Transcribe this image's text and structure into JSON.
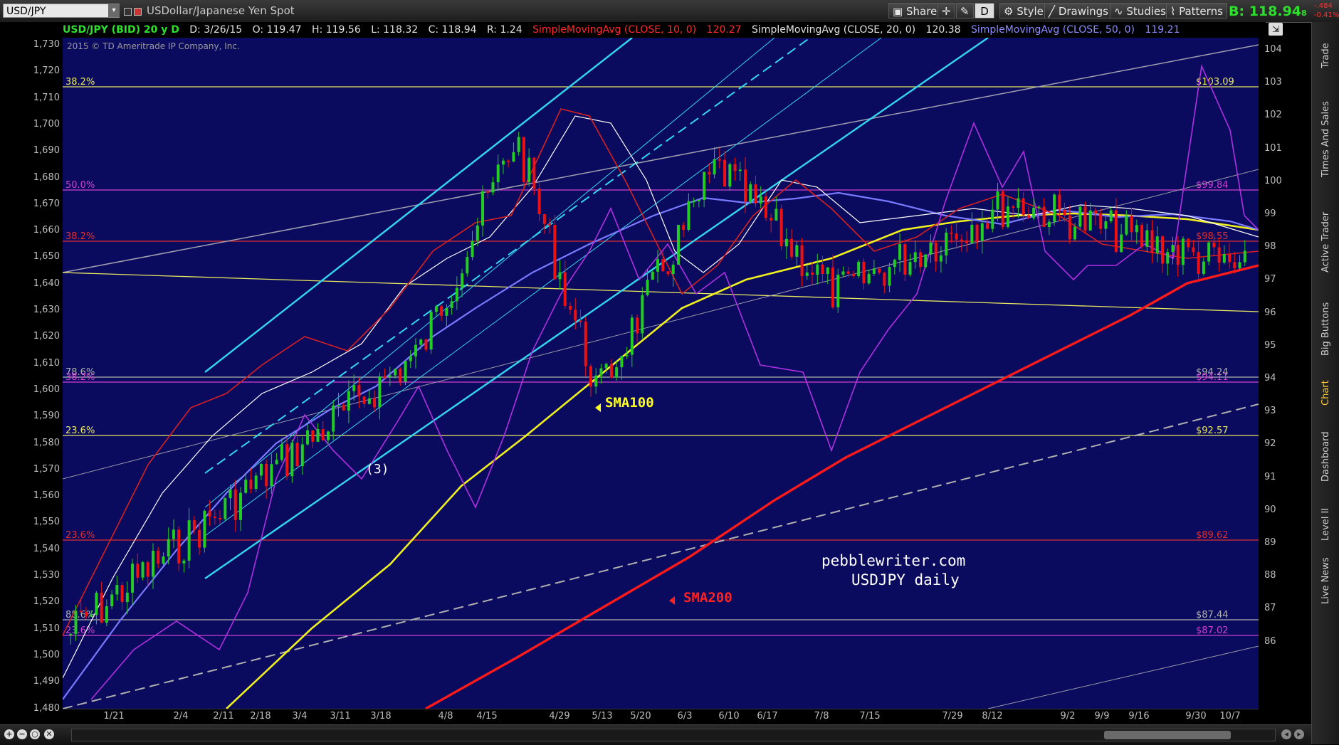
{
  "toolbar": {
    "symbol": "USD/JPY",
    "description": "USDollar/Japanese Yen Spot",
    "buttons": [
      "Share",
      "Style",
      "Drawings",
      "Studies",
      "Patterns"
    ],
    "d_button": "D",
    "quote_b": "B: 118.94",
    "quote_b_sub": "8",
    "change_top": "-.484",
    "change_bottom": "-0.41%"
  },
  "infobar": {
    "symbol": "USD/JPY (BID) 20 y D",
    "date": "D: 3/26/15",
    "open": "O: 119.47",
    "high": "H: 119.56",
    "low": "L: 118.32",
    "close": "C: 118.94",
    "range": "R: 1.24",
    "sma10": "SimpleMovingAvg (CLOSE, 10, 0)",
    "sma10_val": "120.27",
    "sma20": "SimpleMovingAvg (CLOSE, 20, 0)",
    "sma20_val": "120.38",
    "sma50": "SimpleMovingAvg (CLOSE, 50, 0)",
    "sma50_val": "119.21"
  },
  "copyright": "2015 © TD Ameritrade IP Company, Inc.",
  "left_axis_ticks": [
    "1,730",
    "1,720",
    "1,710",
    "1,700",
    "1,690",
    "1,680",
    "1,670",
    "1,660",
    "1,650",
    "1,640",
    "1,630",
    "1,620",
    "1,610",
    "1,600",
    "1,590",
    "1,580",
    "1,570",
    "1,560",
    "1,550",
    "1,540",
    "1,530",
    "1,520",
    "1,510",
    "1,500",
    "1,490",
    "1,480"
  ],
  "right_axis_ticks": [
    "104",
    "103",
    "102",
    "101",
    "100",
    "99",
    "98",
    "97",
    "96",
    "95",
    "94",
    "93",
    "92",
    "91",
    "90",
    "89",
    "88",
    "87",
    "86"
  ],
  "x_axis_ticks": [
    "1/21",
    "2/4",
    "2/11",
    "2/18",
    "3/4",
    "3/11",
    "3/18",
    "4/8",
    "4/15",
    "4/29",
    "5/13",
    "5/20",
    "6/3",
    "6/10",
    "6/17",
    "7/8",
    "7/15",
    "7/29",
    "8/12",
    "9/2",
    "9/9",
    "9/16",
    "9/30",
    "10/7"
  ],
  "fib_levels": [
    {
      "left": "38.2%",
      "right": "$103.09",
      "color": "#e8e860"
    },
    {
      "left": "50.0%",
      "right": "$99.84",
      "color": "#d040d0"
    },
    {
      "left": "38.2%",
      "right": "$98.55",
      "color": "#e03030"
    },
    {
      "left": "78.6%",
      "right": "$94.24",
      "color": "#b0b0b0"
    },
    {
      "left": "38.2%",
      "right": "$94.11",
      "color": "#d040d0"
    },
    {
      "left": "23.6%",
      "right": "$92.57",
      "color": "#e8e860"
    },
    {
      "left": "23.6%",
      "right": "$89.62",
      "color": "#e03030"
    },
    {
      "left": "88.6%",
      "right": "$87.44",
      "color": "#b0b0b0"
    },
    {
      "left": "23.6%",
      "right": "$87.02",
      "color": "#d040d0"
    }
  ],
  "annotations": {
    "sma100": "SMA100",
    "sma200": "SMA200",
    "wave": "(3)",
    "site": "pebblewriter.com",
    "subtitle": "USDJPY daily"
  },
  "side_tabs": [
    "Trade",
    "Times And Sales",
    "Active Trader",
    "Big Buttons",
    "Chart",
    "Dashboard",
    "Level II",
    "Live News"
  ],
  "colors": {
    "plot_bg": "#0a0a5e",
    "cyan": "#33d6ee",
    "sma100": "#f0f020",
    "sma200": "#ff1a1a",
    "purple": "#b030e0",
    "up_candle": "#22cc22",
    "down_candle": "#ee1111"
  }
}
